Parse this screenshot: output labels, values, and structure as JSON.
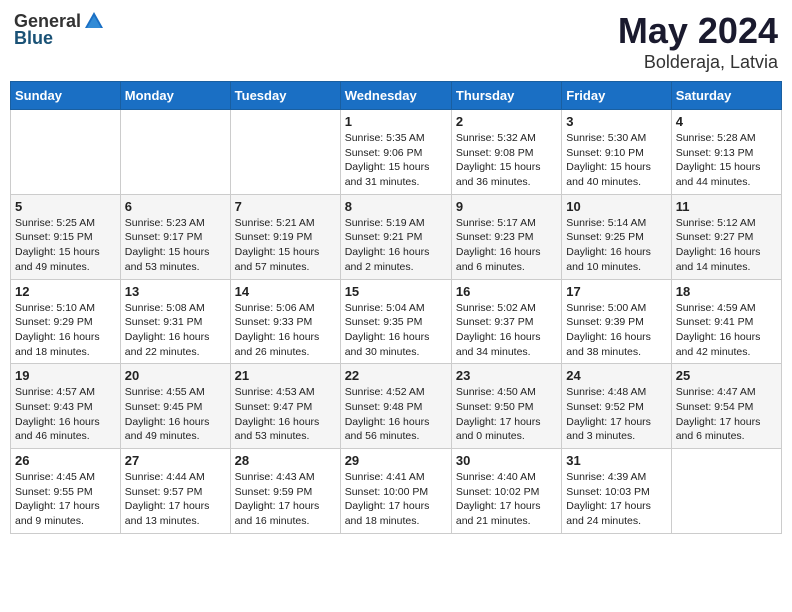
{
  "logo": {
    "general": "General",
    "blue": "Blue",
    "icon": "▶"
  },
  "title": {
    "month": "May 2024",
    "location": "Bolderaja, Latvia"
  },
  "days": [
    "Sunday",
    "Monday",
    "Tuesday",
    "Wednesday",
    "Thursday",
    "Friday",
    "Saturday"
  ],
  "weeks": [
    [
      {
        "day": "",
        "info": ""
      },
      {
        "day": "",
        "info": ""
      },
      {
        "day": "",
        "info": ""
      },
      {
        "day": "1",
        "info": "Sunrise: 5:35 AM\nSunset: 9:06 PM\nDaylight: 15 hours\nand 31 minutes."
      },
      {
        "day": "2",
        "info": "Sunrise: 5:32 AM\nSunset: 9:08 PM\nDaylight: 15 hours\nand 36 minutes."
      },
      {
        "day": "3",
        "info": "Sunrise: 5:30 AM\nSunset: 9:10 PM\nDaylight: 15 hours\nand 40 minutes."
      },
      {
        "day": "4",
        "info": "Sunrise: 5:28 AM\nSunset: 9:13 PM\nDaylight: 15 hours\nand 44 minutes."
      }
    ],
    [
      {
        "day": "5",
        "info": "Sunrise: 5:25 AM\nSunset: 9:15 PM\nDaylight: 15 hours\nand 49 minutes."
      },
      {
        "day": "6",
        "info": "Sunrise: 5:23 AM\nSunset: 9:17 PM\nDaylight: 15 hours\nand 53 minutes."
      },
      {
        "day": "7",
        "info": "Sunrise: 5:21 AM\nSunset: 9:19 PM\nDaylight: 15 hours\nand 57 minutes."
      },
      {
        "day": "8",
        "info": "Sunrise: 5:19 AM\nSunset: 9:21 PM\nDaylight: 16 hours\nand 2 minutes."
      },
      {
        "day": "9",
        "info": "Sunrise: 5:17 AM\nSunset: 9:23 PM\nDaylight: 16 hours\nand 6 minutes."
      },
      {
        "day": "10",
        "info": "Sunrise: 5:14 AM\nSunset: 9:25 PM\nDaylight: 16 hours\nand 10 minutes."
      },
      {
        "day": "11",
        "info": "Sunrise: 5:12 AM\nSunset: 9:27 PM\nDaylight: 16 hours\nand 14 minutes."
      }
    ],
    [
      {
        "day": "12",
        "info": "Sunrise: 5:10 AM\nSunset: 9:29 PM\nDaylight: 16 hours\nand 18 minutes."
      },
      {
        "day": "13",
        "info": "Sunrise: 5:08 AM\nSunset: 9:31 PM\nDaylight: 16 hours\nand 22 minutes."
      },
      {
        "day": "14",
        "info": "Sunrise: 5:06 AM\nSunset: 9:33 PM\nDaylight: 16 hours\nand 26 minutes."
      },
      {
        "day": "15",
        "info": "Sunrise: 5:04 AM\nSunset: 9:35 PM\nDaylight: 16 hours\nand 30 minutes."
      },
      {
        "day": "16",
        "info": "Sunrise: 5:02 AM\nSunset: 9:37 PM\nDaylight: 16 hours\nand 34 minutes."
      },
      {
        "day": "17",
        "info": "Sunrise: 5:00 AM\nSunset: 9:39 PM\nDaylight: 16 hours\nand 38 minutes."
      },
      {
        "day": "18",
        "info": "Sunrise: 4:59 AM\nSunset: 9:41 PM\nDaylight: 16 hours\nand 42 minutes."
      }
    ],
    [
      {
        "day": "19",
        "info": "Sunrise: 4:57 AM\nSunset: 9:43 PM\nDaylight: 16 hours\nand 46 minutes."
      },
      {
        "day": "20",
        "info": "Sunrise: 4:55 AM\nSunset: 9:45 PM\nDaylight: 16 hours\nand 49 minutes."
      },
      {
        "day": "21",
        "info": "Sunrise: 4:53 AM\nSunset: 9:47 PM\nDaylight: 16 hours\nand 53 minutes."
      },
      {
        "day": "22",
        "info": "Sunrise: 4:52 AM\nSunset: 9:48 PM\nDaylight: 16 hours\nand 56 minutes."
      },
      {
        "day": "23",
        "info": "Sunrise: 4:50 AM\nSunset: 9:50 PM\nDaylight: 17 hours\nand 0 minutes."
      },
      {
        "day": "24",
        "info": "Sunrise: 4:48 AM\nSunset: 9:52 PM\nDaylight: 17 hours\nand 3 minutes."
      },
      {
        "day": "25",
        "info": "Sunrise: 4:47 AM\nSunset: 9:54 PM\nDaylight: 17 hours\nand 6 minutes."
      }
    ],
    [
      {
        "day": "26",
        "info": "Sunrise: 4:45 AM\nSunset: 9:55 PM\nDaylight: 17 hours\nand 9 minutes."
      },
      {
        "day": "27",
        "info": "Sunrise: 4:44 AM\nSunset: 9:57 PM\nDaylight: 17 hours\nand 13 minutes."
      },
      {
        "day": "28",
        "info": "Sunrise: 4:43 AM\nSunset: 9:59 PM\nDaylight: 17 hours\nand 16 minutes."
      },
      {
        "day": "29",
        "info": "Sunrise: 4:41 AM\nSunset: 10:00 PM\nDaylight: 17 hours\nand 18 minutes."
      },
      {
        "day": "30",
        "info": "Sunrise: 4:40 AM\nSunset: 10:02 PM\nDaylight: 17 hours\nand 21 minutes."
      },
      {
        "day": "31",
        "info": "Sunrise: 4:39 AM\nSunset: 10:03 PM\nDaylight: 17 hours\nand 24 minutes."
      },
      {
        "day": "",
        "info": ""
      }
    ]
  ]
}
